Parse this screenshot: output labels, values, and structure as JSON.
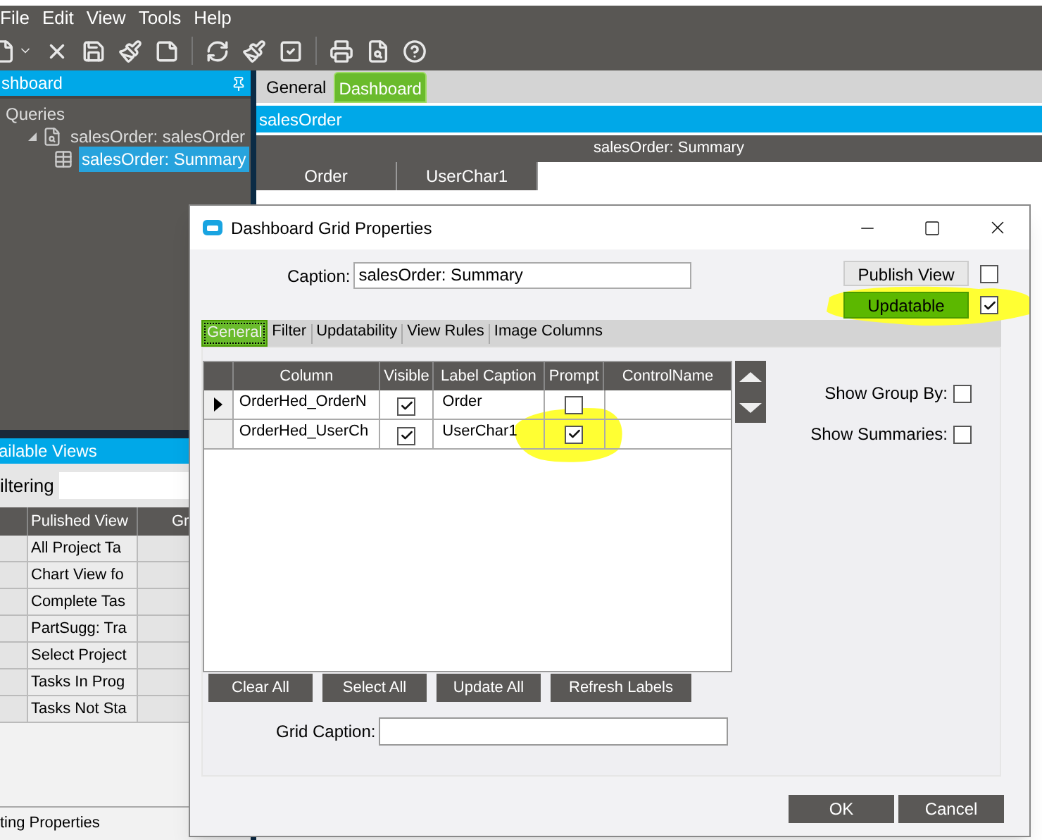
{
  "menu": [
    "File",
    "Edit",
    "View",
    "Tools",
    "Help"
  ],
  "left_panel": {
    "title": "shboard",
    "tree": [
      {
        "label": "Queries",
        "children": [
          {
            "label": "salesOrder: salesOrder",
            "expanded": true,
            "children": [
              {
                "label": "salesOrder: Summary",
                "selected": true
              }
            ]
          }
        ]
      }
    ]
  },
  "views_panel": {
    "title": "ailable Views",
    "filter_label": "iltering",
    "columns": [
      "Pulished View",
      "Gr"
    ],
    "rows": [
      "All Project Ta",
      "Chart View fo",
      "Complete Tas",
      "PartSugg: Tra",
      "Select Project",
      "Tasks In Prog",
      "Tasks Not Sta"
    ],
    "footer": "ting Properties"
  },
  "main_tabs": [
    {
      "label": "General",
      "selected": false
    },
    {
      "label": "Dashboard",
      "selected": true
    }
  ],
  "query_bar": "salesOrder",
  "grid_title": "salesOrder: Summary",
  "grid_columns": [
    "Order",
    "UserChar1"
  ],
  "dialog": {
    "title": "Dashboard Grid Properties",
    "caption_label": "Caption:",
    "caption_value": "salesOrder: Summary",
    "publish_button": "Publish View",
    "publish_checked": false,
    "updatable_button": "Updatable",
    "updatable_checked": true,
    "tabs": [
      {
        "label": "General",
        "selected": true
      },
      {
        "label": "Filter",
        "selected": false
      },
      {
        "label": "Updatability",
        "selected": false
      },
      {
        "label": "View Rules",
        "selected": false
      },
      {
        "label": "Image Columns",
        "selected": false
      }
    ],
    "grid": {
      "columns": [
        "Column",
        "Visible",
        "Label Caption",
        "Prompt",
        "ControlName"
      ],
      "rows": [
        {
          "column": "OrderHed_OrderN",
          "visible": true,
          "label": "Order",
          "prompt": false,
          "selected": true
        },
        {
          "column": "OrderHed_UserCh",
          "visible": true,
          "label": "UserChar1",
          "prompt": true,
          "selected": false
        }
      ]
    },
    "options": [
      {
        "label": "Show Group By:",
        "checked": false
      },
      {
        "label": "Show Summaries:",
        "checked": false
      }
    ],
    "grid_buttons": [
      "Clear All",
      "Select All",
      "Update All",
      "Refresh Labels"
    ],
    "grid_caption_label": "Grid Caption:",
    "footer_buttons": [
      "OK",
      "Cancel"
    ]
  }
}
